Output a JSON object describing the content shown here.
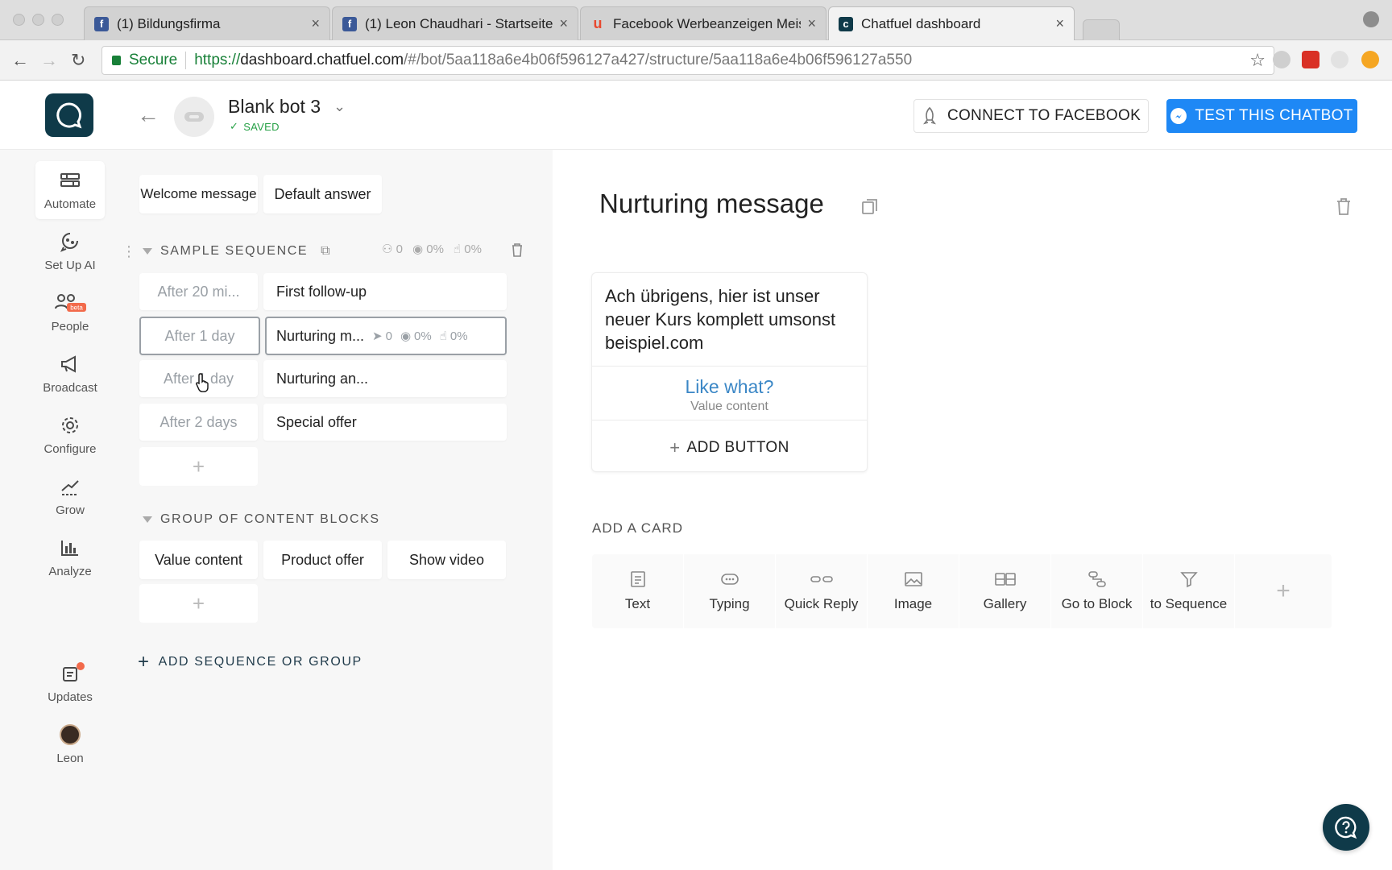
{
  "browser": {
    "tabs": [
      {
        "label": "(1) Bildungsfirma",
        "favicon": "facebook-icon"
      },
      {
        "label": "(1) Leon Chaudhari - Startseite",
        "favicon": "facebook-icon"
      },
      {
        "label": "Facebook Werbeanzeigen Meis",
        "favicon": "udemy-icon"
      },
      {
        "label": "Chatfuel dashboard",
        "favicon": "chatfuel-icon",
        "active": true
      }
    ],
    "secure_label": "Secure",
    "url_scheme": "https://",
    "url_host": "dashboard.chatfuel.com",
    "url_path": "/#/bot/5aa118a6e4b06f596127a427/structure/5aa118a6e4b06f596127a550"
  },
  "header": {
    "bot_name": "Blank bot 3",
    "saved_label": "SAVED",
    "connect_button": "CONNECT TO FACEBOOK",
    "test_button": "TEST THIS CHATBOT"
  },
  "leftnav": {
    "items": [
      {
        "label": "Automate",
        "icon": "automate-icon"
      },
      {
        "label": "Set Up AI",
        "icon": "ai-brain-icon"
      },
      {
        "label": "People",
        "icon": "people-icon",
        "badge": "beta"
      },
      {
        "label": "Broadcast",
        "icon": "megaphone-icon"
      },
      {
        "label": "Configure",
        "icon": "gear-icon"
      },
      {
        "label": "Grow",
        "icon": "grow-icon"
      },
      {
        "label": "Analyze",
        "icon": "bar-chart-icon"
      }
    ],
    "updates_label": "Updates",
    "user_label": "Leon"
  },
  "structure": {
    "top_blocks": [
      "Welcome message",
      "Default answer"
    ],
    "sequence": {
      "title": "SAMPLE SEQUENCE",
      "stats": {
        "users": "0",
        "seen": "0%",
        "clicked": "0%"
      },
      "rows": [
        {
          "timing": "After 20 mi...",
          "block": "First follow-up"
        },
        {
          "timing": "After 1 day",
          "block": "Nurturing m...",
          "stats": {
            "sent": "0",
            "seen": "0%",
            "clicked": "0%"
          },
          "selected": true
        },
        {
          "timing": "After 1 day",
          "block": "Nurturing an..."
        },
        {
          "timing": "After 2 days",
          "block": "Special offer"
        }
      ]
    },
    "group": {
      "title": "GROUP OF CONTENT BLOCKS",
      "blocks": [
        "Value content",
        "Product offer",
        "Show video"
      ]
    },
    "add_sequence_label": "ADD SEQUENCE OR GROUP"
  },
  "main": {
    "block_title": "Nurturing message",
    "card": {
      "text": "Ach übrigens, hier ist unser neuer Kurs komplett umsonst beispiel.com",
      "button_title": "Like what?",
      "button_target": "Value content",
      "add_button_label": "ADD BUTTON"
    },
    "add_card_label": "ADD A CARD",
    "card_types": [
      {
        "label": "Text",
        "icon": "text-icon"
      },
      {
        "label": "Typing",
        "icon": "typing-icon"
      },
      {
        "label": "Quick Reply",
        "icon": "quick-reply-icon"
      },
      {
        "label": "Image",
        "icon": "image-icon"
      },
      {
        "label": "Gallery",
        "icon": "gallery-icon"
      },
      {
        "label": "Go to Block",
        "icon": "go-to-block-icon"
      },
      {
        "label": "to Sequence",
        "icon": "funnel-icon"
      }
    ]
  }
}
